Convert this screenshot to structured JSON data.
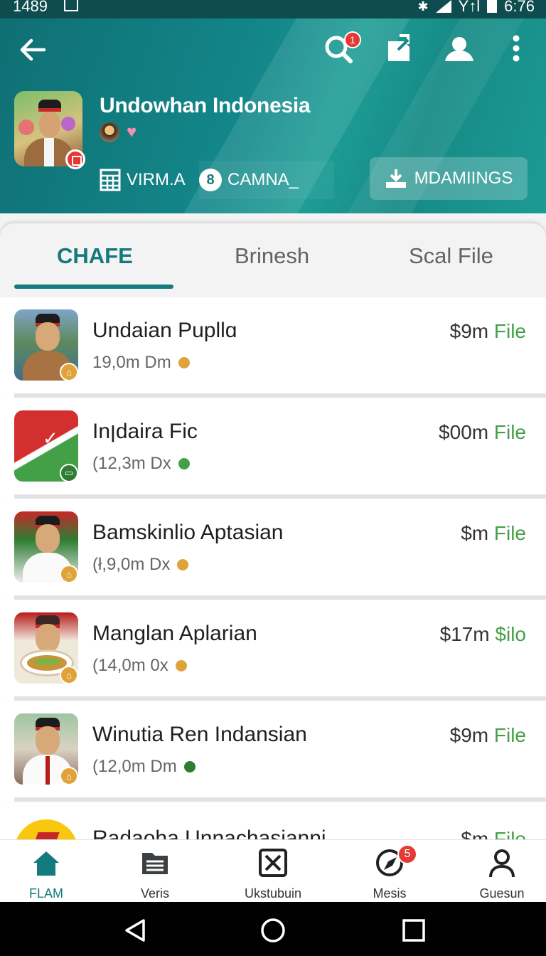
{
  "status_bar": {
    "time_left": "1489",
    "signal_text": "Y↑l",
    "clock": "6:76"
  },
  "header": {
    "channel_name": "Undowhan Indonesia",
    "search_badge": "1",
    "chip_a_label": "VIRM.A",
    "chip_b_label": "CAMNA_",
    "chip_b_icon_text": "8",
    "download_button_label": "MDAMIINGS"
  },
  "tabs": [
    {
      "label": "CHAFE",
      "active": true
    },
    {
      "label": "Brinesh",
      "active": false
    },
    {
      "label": "Scal File",
      "active": false
    }
  ],
  "list": [
    {
      "title": "Undaian Pupllɑ",
      "subtitle": "19,0m Dm",
      "price": "$9m",
      "file_type": "File",
      "status_color": "#e0a33a"
    },
    {
      "title": "Inןdaira Fic",
      "subtitle": "(12,3m Dx",
      "price": "$00m",
      "file_type": "File",
      "status_color": "#43a047"
    },
    {
      "title": "Bamskinlio Aptasian",
      "subtitle": "(ł,9,0m Dx",
      "price": "$m",
      "file_type": "File",
      "status_color": "#e0a33a"
    },
    {
      "title": "Manglan Aplarian",
      "subtitle": "(14,0m 0x",
      "price": "$17m",
      "file_type": "$ilo",
      "status_color": "#e0a33a"
    },
    {
      "title": "Winutia Ren Indansian",
      "subtitle": "(12,0m Dm",
      "price": "$9m",
      "file_type": "File",
      "status_color": "#2e7d32"
    },
    {
      "title": "Radaoha Unnachasianni",
      "subtitle": "",
      "price": "$m",
      "file_type": "Filo",
      "status_color": "#e0a33a"
    }
  ],
  "bottom_nav": [
    {
      "label": "FLAM",
      "icon": "home-icon",
      "active": true
    },
    {
      "label": "Veris",
      "icon": "folder-list-icon",
      "active": false
    },
    {
      "label": "Ukstubuin",
      "icon": "close-box-icon",
      "active": false
    },
    {
      "label": "Mesis",
      "icon": "compass-icon",
      "active": false,
      "badge": "5"
    },
    {
      "label": "Guesun",
      "icon": "person-icon",
      "active": false
    }
  ],
  "colors": {
    "accent": "#137a7d",
    "header_bg": "#13878a",
    "file_green": "#43a047",
    "badge_red": "#e53935"
  }
}
